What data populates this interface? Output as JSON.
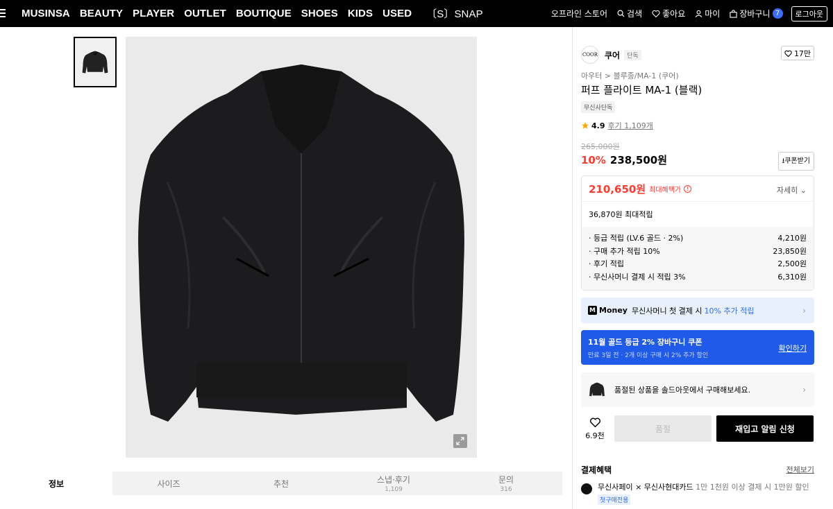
{
  "topnav": {
    "items": [
      "MUSINSA",
      "BEAUTY",
      "PLAYER",
      "OUTLET",
      "BOUTIQUE",
      "SHOES",
      "KIDS",
      "USED",
      "〔S〕SNAP"
    ],
    "right": {
      "offline": "오프라인 스토어",
      "search": "검색",
      "like": "좋아요",
      "my": "마이",
      "cart": "장바구니",
      "cart_count": "7",
      "logout": "로그아웃"
    }
  },
  "detail_tabs": [
    {
      "label": "정보",
      "count": ""
    },
    {
      "label": "사이즈",
      "count": ""
    },
    {
      "label": "추천",
      "count": ""
    },
    {
      "label": "스냅·후기",
      "count": "1,109"
    },
    {
      "label": "문의",
      "count": "316"
    }
  ],
  "product": {
    "brand_logo": "COOR",
    "brand": "쿠어",
    "brand_tag": "단독",
    "likes": "17만",
    "breadcrumb": "아우터 > 블루종/MA-1 (쿠어)",
    "title": "퍼프 플라이트 MA-1 (블랙)",
    "tag": "무신사단독",
    "rating": "4.9",
    "reviews": "후기 1,109개",
    "original_price": "265,000원",
    "discount": "10%",
    "price": "238,500원",
    "coupon_button": "쿠폰받기"
  },
  "benefit": {
    "max_price": "210,650원",
    "max_label": "최대혜택가",
    "detail": "자세히",
    "savings": "36,870원 최대적립",
    "rows": [
      {
        "label": "· 등급 적립 (LV.6 골드 · 2%)",
        "value": "4,210원"
      },
      {
        "label": "· 구매 추가 적립 10%",
        "value": "23,850원"
      },
      {
        "label": "· 후기 적립",
        "value": "2,500원"
      },
      {
        "label": "· 무신사머니 결제 시 적립 3%",
        "value": "6,310원"
      }
    ]
  },
  "money": {
    "brand": "Money",
    "text": "무신사머니 첫 결제 시",
    "highlight": "10% 추가 적립"
  },
  "coupon_banner": {
    "title": "11월 골드 등급 2% 장바구니 쿠폰",
    "subtitle": "만료 3일 전 · 2개 이상 구매 시 2% 추가 할인",
    "action": "확인하기"
  },
  "soldout_banner": "품절된 상품을 솔드아웃에서 구매해보세요.",
  "actions": {
    "wish_count": "6.9천",
    "soldout": "품절",
    "restock": "재입고 알림 신청"
  },
  "payment": {
    "title": "결제혜택",
    "view_all": "전체보기",
    "item_title": "무신사페이 × 무신사현대카드",
    "item_desc": "1만 1천원 이상 결제 시 1만원 할인",
    "item_badge": "첫구매전용"
  }
}
